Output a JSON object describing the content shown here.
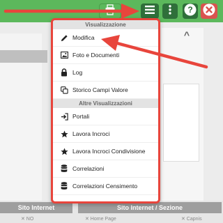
{
  "toolbar": {
    "buttons": [
      {
        "name": "print",
        "icon": "print-icon"
      },
      {
        "name": "menu",
        "icon": "hamburger-menu-icon"
      },
      {
        "name": "more",
        "icon": "more-vertical-icon"
      },
      {
        "name": "help",
        "icon": "help-icon",
        "label": "?"
      },
      {
        "name": "close",
        "icon": "close-icon"
      }
    ],
    "colors": {
      "bar": "#5cb85c",
      "button": "#2f6f3a",
      "close": "#d9534f"
    }
  },
  "background": {
    "chevron": "^",
    "table_headers": [
      "Sito Internet",
      "Sito Internet / Sezione"
    ],
    "table_subcells": [
      "✕ NO",
      "✕ Home Page",
      "✕ Capnis"
    ]
  },
  "menu": {
    "border_color": "#e8453c",
    "sections": [
      {
        "title": "Visualizzazione",
        "items": [
          {
            "label": "Modifica",
            "icon": "pencil-icon"
          },
          {
            "label": "Foto e Documenti",
            "icon": "image-icon"
          },
          {
            "label": "Log",
            "icon": "lock-icon"
          },
          {
            "label": "Storico Campi Valore",
            "icon": "copy-icon"
          }
        ]
      },
      {
        "title": "Altre Visualizzazioni",
        "items": [
          {
            "label": "Portali",
            "icon": "sign-in-icon"
          },
          {
            "label": "Lavora Incroci",
            "icon": "star-icon"
          },
          {
            "label": "Lavora Incroci Condivisione",
            "icon": "star-icon"
          },
          {
            "label": "Correlazioni",
            "icon": "database-icon"
          },
          {
            "label": "Correlazioni Censimento",
            "icon": "database-icon"
          }
        ]
      }
    ]
  },
  "annotations": {
    "arrow_color": "#e8453c"
  }
}
